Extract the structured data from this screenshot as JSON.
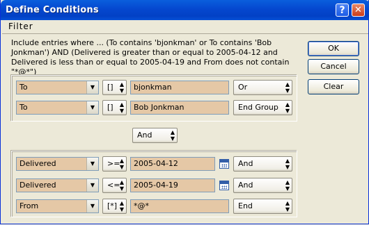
{
  "window": {
    "title": "Define Conditions",
    "help_glyph": "?",
    "close_glyph": "✕"
  },
  "menu": {
    "filter": "Filter"
  },
  "description": "Include entries where ... (To  contains 'bjonkman' or To  contains 'Bob Jonkman') AND (Delivered is greater than or equal to 2005-04-12 and Delivered is less than or equal to 2005-04-19 and From  does not contain \"*@*\")",
  "buttons": {
    "ok": "OK",
    "cancel": "Cancel",
    "clear": "Clear"
  },
  "group1": {
    "rows": [
      {
        "field": "To",
        "operator": "[]",
        "value": "bjonkman",
        "logic": "Or"
      },
      {
        "field": "To",
        "operator": "[]",
        "value": "Bob Jonkman",
        "logic": "End Group"
      }
    ]
  },
  "between_groups": {
    "logic": "And"
  },
  "group2": {
    "rows": [
      {
        "field": "Delivered",
        "operator": ">=",
        "value": "2005-04-12",
        "logic": "And",
        "calendar_icon": "calendar-icon"
      },
      {
        "field": "Delivered",
        "operator": "<=",
        "value": "2005-04-19",
        "logic": "And",
        "calendar_icon": "calendar-icon"
      },
      {
        "field": "From",
        "operator": "[*]",
        "value": "*@*",
        "logic": "End"
      }
    ]
  },
  "glyphs": {
    "combo_arrow": "▼",
    "spin_up": "▲",
    "spin_down": "▼"
  },
  "colors": {
    "field_bg": "#e5c8a6",
    "title_blue": "#0547cf",
    "dialog_bg": "#ece9d8"
  }
}
